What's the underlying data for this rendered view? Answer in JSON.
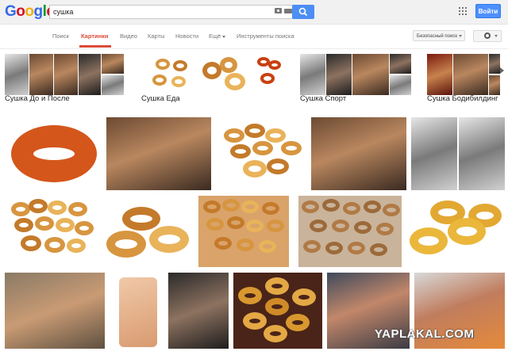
{
  "header": {
    "logo_letters": [
      "G",
      "o",
      "o",
      "g",
      "l",
      "e"
    ],
    "logo_colors": [
      "#3369e8",
      "#d50f25",
      "#eeb211",
      "#3369e8",
      "#009925",
      "#d50f25"
    ],
    "search_value": "сушка",
    "signin_label": "Войти"
  },
  "nav": {
    "tabs": [
      {
        "label": "Поиск"
      },
      {
        "label": "Картинки"
      },
      {
        "label": "Видео"
      },
      {
        "label": "Карты"
      },
      {
        "label": "Новости"
      },
      {
        "label": "Ещё"
      },
      {
        "label": "Инструменты поиска"
      }
    ],
    "safesearch_label": "Безопасный поиск"
  },
  "related": [
    {
      "label": "Сушка До и После"
    },
    {
      "label": "Сушка Еда"
    },
    {
      "label": "Сушка Спорт"
    },
    {
      "label": "Сушка Бодибилдинг"
    }
  ],
  "watermark": "YAPLAKAL.COM",
  "colors": {
    "accent_red": "#dd4b39",
    "search_blue": "#4c8ef5",
    "signin_blue": "#4d90fe"
  }
}
